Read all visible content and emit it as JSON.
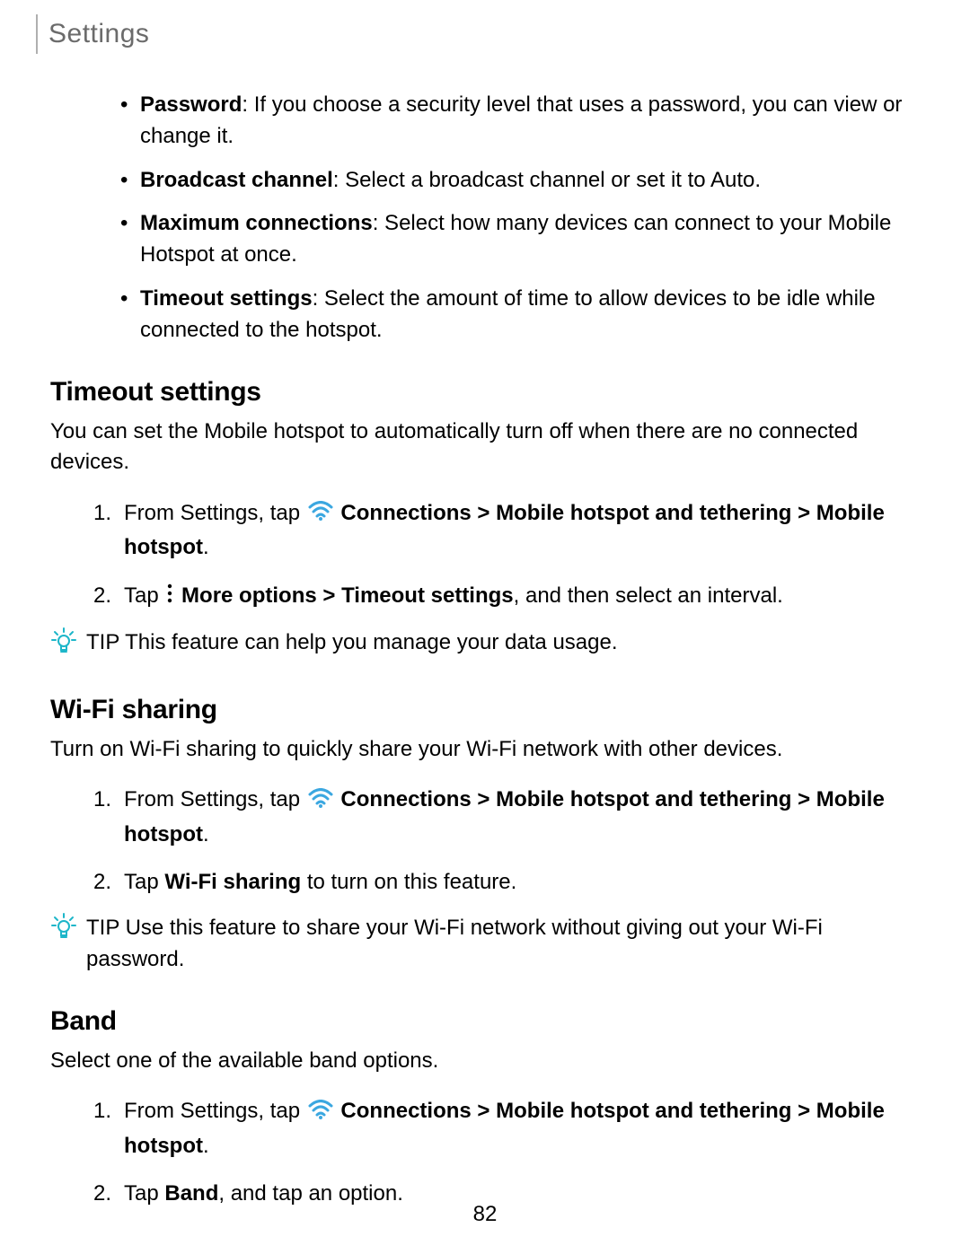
{
  "header": {
    "title": "Settings"
  },
  "bullets": [
    {
      "label": "Password",
      "text": ": If you choose a security level that uses a password, you can view or change it."
    },
    {
      "label": "Broadcast channel",
      "text": ": Select a broadcast channel or set it to Auto."
    },
    {
      "label": "Maximum connections",
      "text": ": Select how many devices can connect to your Mobile Hotspot at once."
    },
    {
      "label": "Timeout settings",
      "text": ": Select the amount of time to allow devices to be idle while connected to the hotspot."
    }
  ],
  "sections": {
    "timeout": {
      "title": "Timeout settings",
      "lead": "You can set the Mobile hotspot to automatically turn off when there are no connected devices.",
      "step1_pre": "From Settings, tap ",
      "step1_conn": "Connections",
      "step1_sep1": " > ",
      "step1_mht": "Mobile hotspot and tethering",
      "step1_sep2": " > ",
      "step1_mh": "Mobile hotspot",
      "step1_end": ".",
      "step2_pre": "Tap ",
      "step2_more": "More options",
      "step2_sep": " > ",
      "step2_ts": "Timeout settings",
      "step2_end": ", and then select an interval.",
      "tip_label": "TIP",
      "tip_text": "  This feature can help you manage your data usage."
    },
    "wifi": {
      "title": "Wi-Fi sharing",
      "lead": "Turn on Wi-Fi sharing to quickly share your Wi-Fi network with other devices.",
      "step1_pre": "From Settings, tap ",
      "step1_conn": "Connections",
      "step1_sep1": " > ",
      "step1_mht": "Mobile hotspot and tethering",
      "step1_sep2": " > ",
      "step1_mh": "Mobile hotspot",
      "step1_end": ".",
      "step2_pre": "Tap ",
      "step2_ws": "Wi-Fi sharing",
      "step2_end": " to turn on this feature.",
      "tip_label": "TIP",
      "tip_text": "  Use this feature to share your Wi-Fi network without giving out your Wi-Fi password."
    },
    "band": {
      "title": "Band",
      "lead": "Select one of the available band options.",
      "step1_pre": "From Settings, tap ",
      "step1_conn": "Connections",
      "step1_sep1": " > ",
      "step1_mht": "Mobile hotspot and tethering",
      "step1_sep2": " > ",
      "step1_mh": "Mobile hotspot",
      "step1_end": ".",
      "step2_pre": "Tap ",
      "step2_band": "Band",
      "step2_end": ", and tap an option."
    }
  },
  "page_number": "82"
}
